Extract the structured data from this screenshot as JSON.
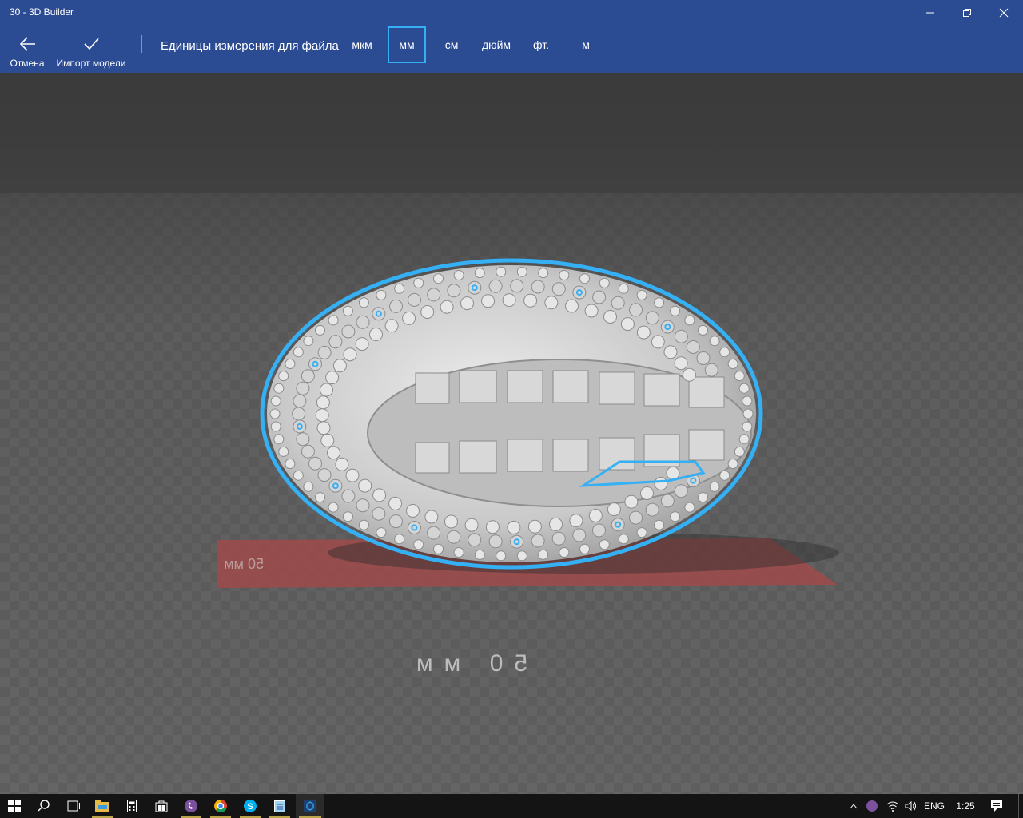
{
  "window": {
    "title": "30 - 3D Builder"
  },
  "toolbar": {
    "cancel_label": "Отмена",
    "import_label": "Импорт модели",
    "units_label": "Единицы измерения для файла",
    "units": [
      "мкм",
      "мм",
      "см",
      "дюйм",
      "фт.",
      "м"
    ],
    "selected_unit": "мм"
  },
  "scene": {
    "ruler_label": "50 мм",
    "selection_color": "#35b0f5",
    "base_plate_color": "#a04a4a"
  },
  "taskbar": {
    "apps": [
      "windows-start",
      "search",
      "task-view",
      "file-explorer",
      "calculator",
      "store",
      "viber",
      "chrome",
      "skype",
      "notepad",
      "3d-builder"
    ],
    "language": "ENG",
    "time": "1:25"
  }
}
